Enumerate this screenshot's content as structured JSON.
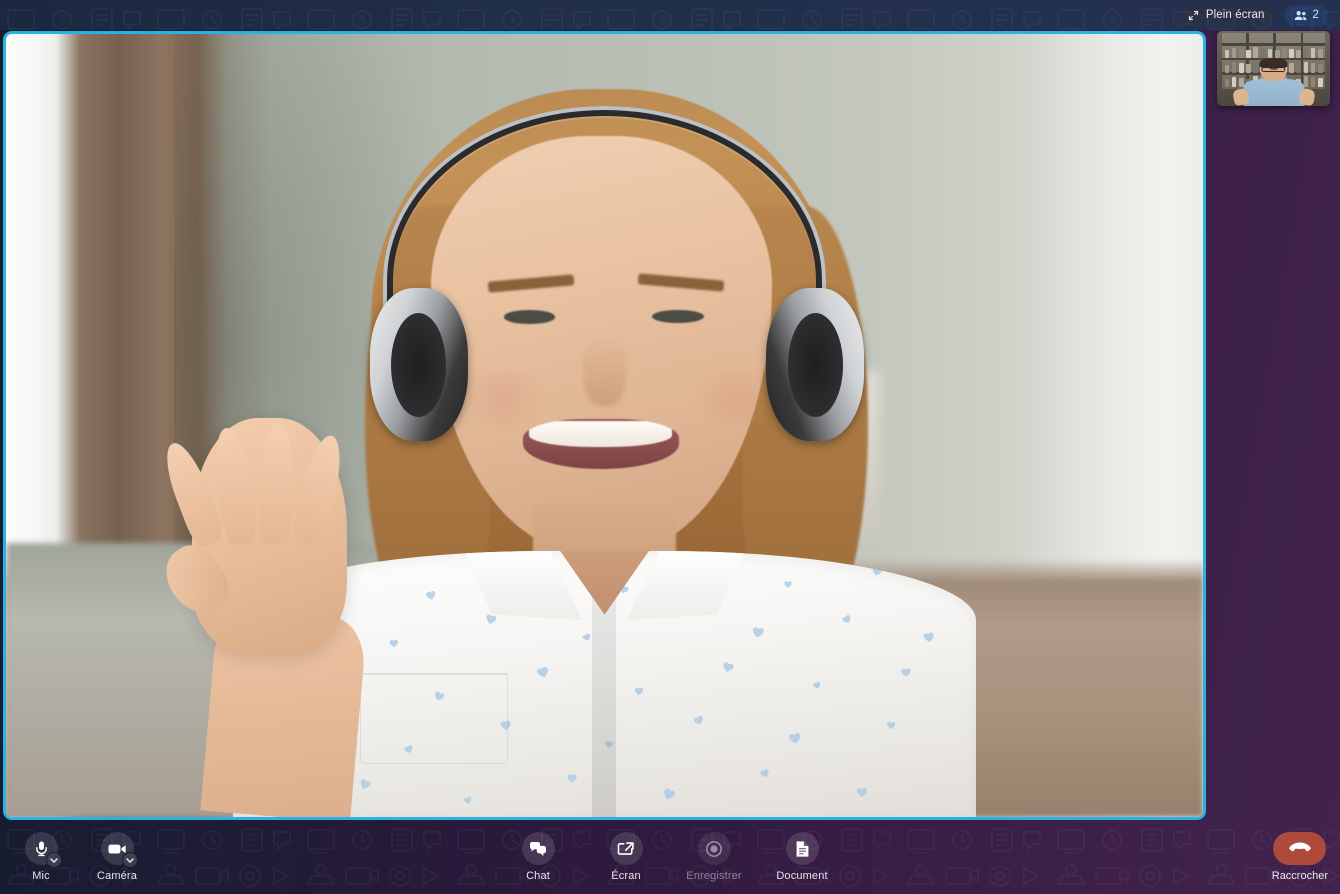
{
  "topbar": {
    "fullscreen_label": "Plein écran",
    "fullscreen_icon": "expand-arrows-icon",
    "participants_icon": "people-icon",
    "participants_count": "2"
  },
  "stage": {
    "border_color": "#29b2e2",
    "remote_participant": {
      "description": "smiling blonde woman wearing silver and black over-ear headphones, waving her right hand, white blouse with small blue hearts, sage green wall, brown curtain and window at left, houseplant and beige sofa behind"
    }
  },
  "pip": {
    "name": "self-view-thumbnail",
    "description": "bearded man with glasses in a light blue shirt gesturing with both hands, bookshelves behind him"
  },
  "toolbar": {
    "left": [
      {
        "id": "mic",
        "label": "Mic",
        "icon": "microphone-icon",
        "has_caret": true,
        "disabled": false
      },
      {
        "id": "camera",
        "label": "Caméra",
        "icon": "video-camera-icon",
        "has_caret": true,
        "disabled": false
      }
    ],
    "center": [
      {
        "id": "chat",
        "label": "Chat",
        "icon": "chat-bubbles-icon",
        "disabled": false
      },
      {
        "id": "screen",
        "label": "Écran",
        "icon": "screen-share-icon",
        "disabled": false
      },
      {
        "id": "record",
        "label": "Enregistrer",
        "icon": "record-circle-icon",
        "disabled": true
      },
      {
        "id": "document",
        "label": "Document",
        "icon": "document-page-icon",
        "disabled": false
      }
    ],
    "hangup": {
      "label": "Raccrocher",
      "icon": "phone-hangup-icon",
      "color": "#ad4a3c"
    }
  },
  "colors": {
    "accent": "#29b2e2",
    "topbar_bg": "#223049",
    "hangup": "#ad4a3c",
    "bg_left": "#141c2e",
    "bg_right": "#41234d"
  }
}
